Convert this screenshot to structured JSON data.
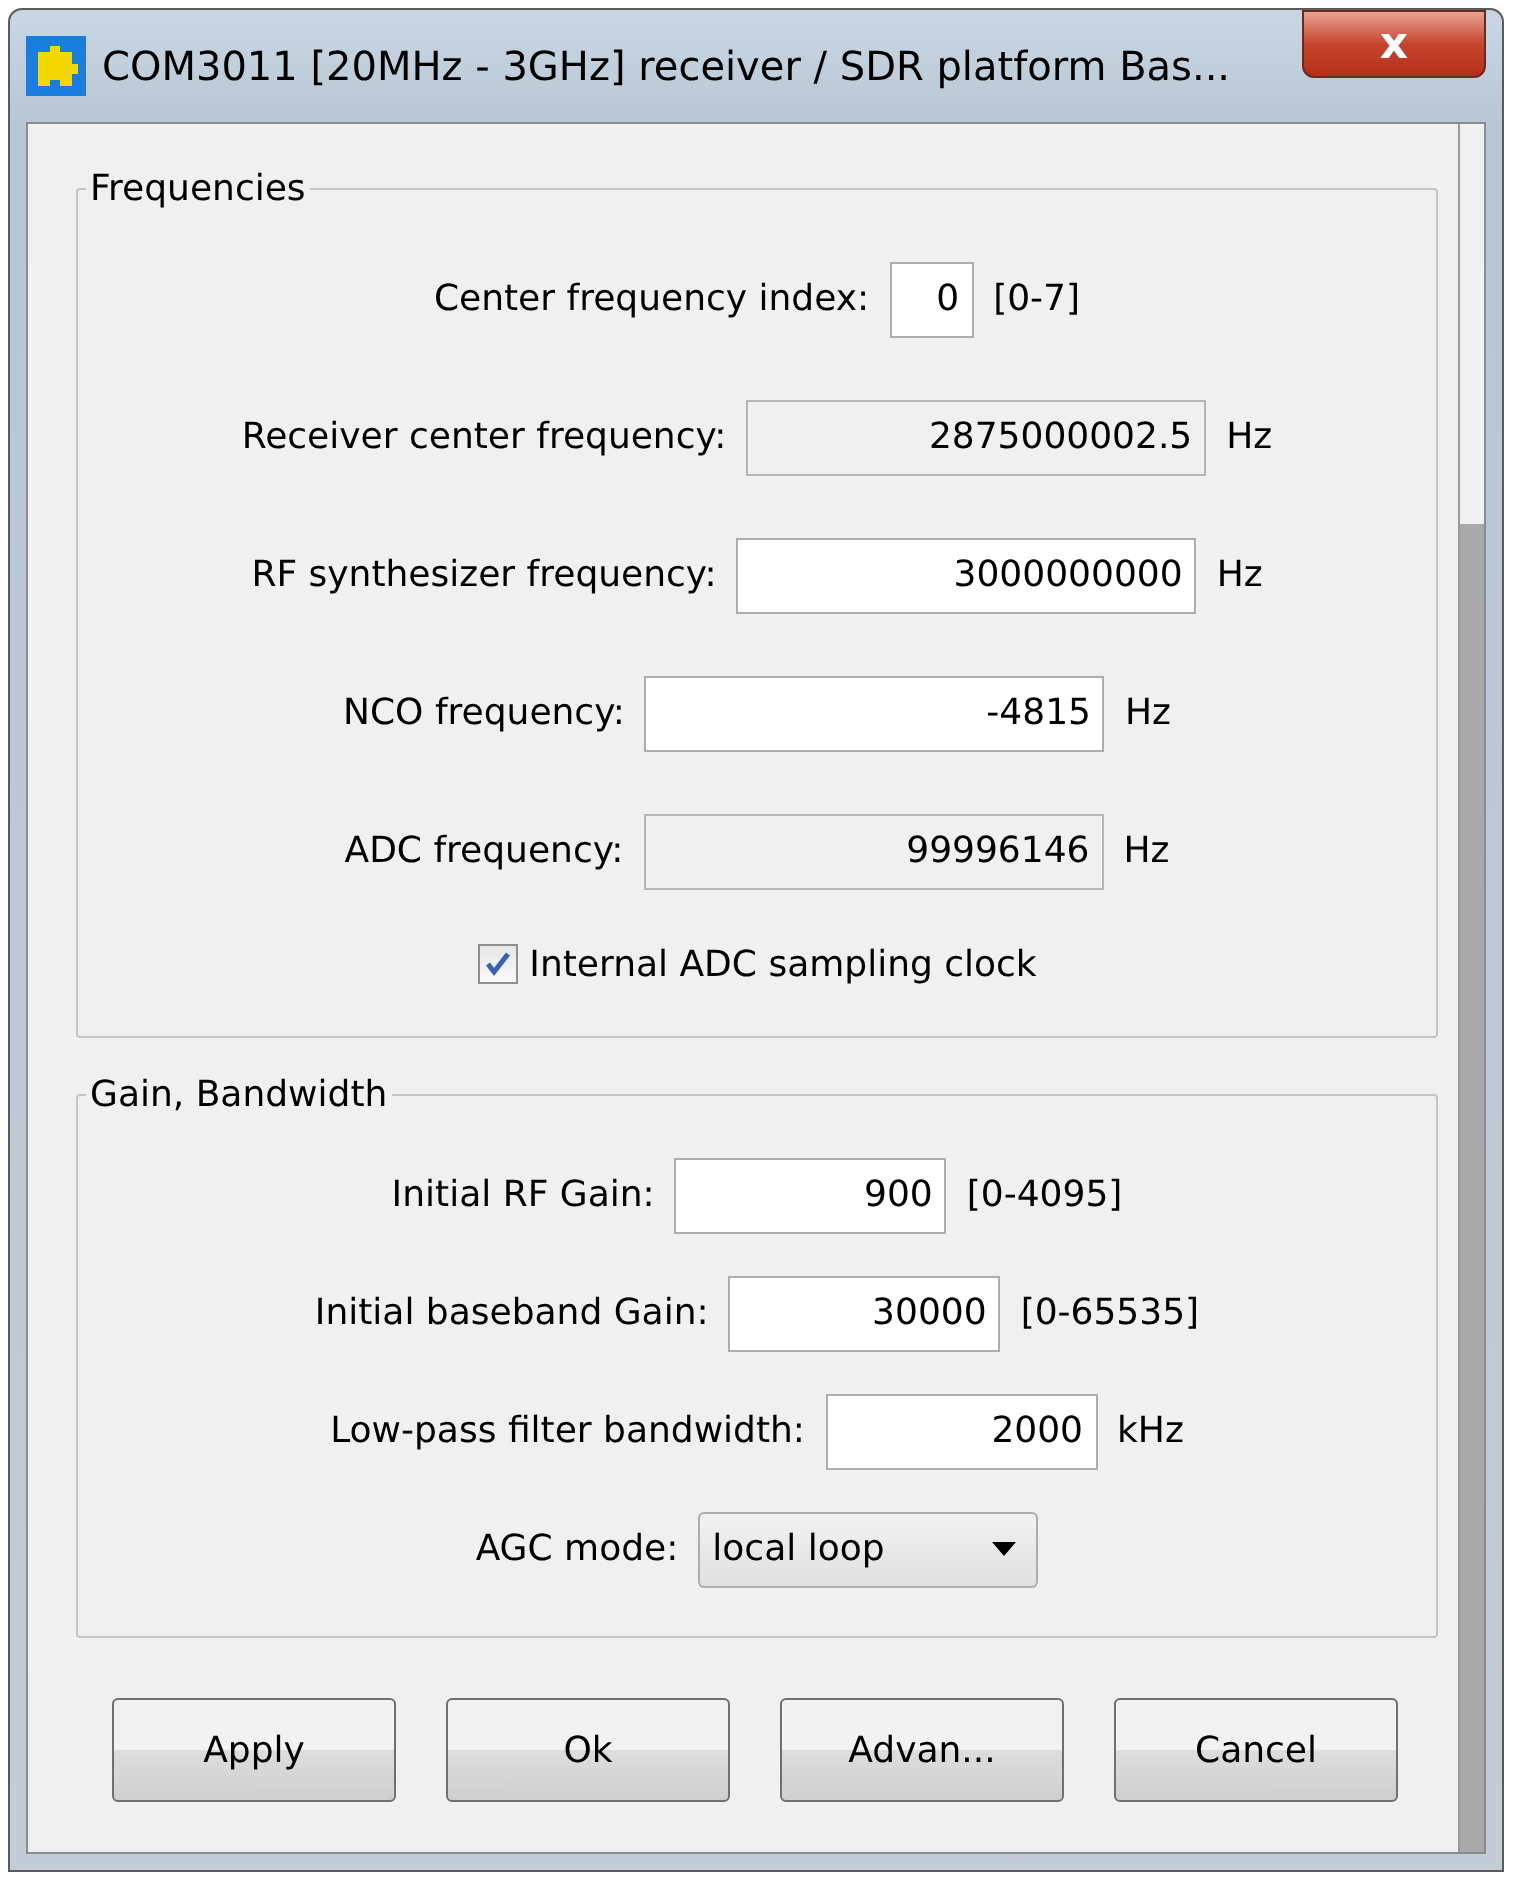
{
  "window": {
    "title": "COM3011 [20MHz - 3GHz] receiver / SDR platform Bas...",
    "close": "x"
  },
  "groups": [
    {
      "title": "Frequencies",
      "rows": [
        {
          "kind": "field",
          "label": "Center frequency index:",
          "value": "0",
          "readonly": false,
          "suffix": "[0-7]"
        },
        {
          "kind": "field",
          "label": "Receiver center frequency:",
          "value": "2875000002.5",
          "readonly": true,
          "suffix": "Hz"
        },
        {
          "kind": "field",
          "label": "RF synthesizer frequency:",
          "value": "3000000000",
          "readonly": false,
          "suffix": "Hz"
        },
        {
          "kind": "field",
          "label": "NCO frequency:",
          "value": "-4815",
          "readonly": false,
          "suffix": "Hz"
        },
        {
          "kind": "field",
          "label": "ADC frequency:",
          "value": "99996146",
          "readonly": true,
          "suffix": "Hz"
        },
        {
          "kind": "checkbox",
          "label": "Internal ADC sampling clock",
          "checked": true
        }
      ]
    },
    {
      "title": "Gain, Bandwidth",
      "rows": [
        {
          "kind": "field",
          "label": "Initial RF Gain:",
          "value": "900",
          "readonly": false,
          "suffix": "[0-4095]"
        },
        {
          "kind": "field",
          "label": "Initial baseband Gain:",
          "value": "30000",
          "readonly": false,
          "suffix": "[0-65535]"
        },
        {
          "kind": "field",
          "label": "Low-pass filter bandwidth:",
          "value": "2000",
          "readonly": false,
          "suffix": "kHz"
        },
        {
          "kind": "select",
          "label": "AGC mode:",
          "value": "local loop"
        }
      ]
    }
  ],
  "buttons": [
    "Apply",
    "Ok",
    "Advan...",
    "Cancel"
  ]
}
